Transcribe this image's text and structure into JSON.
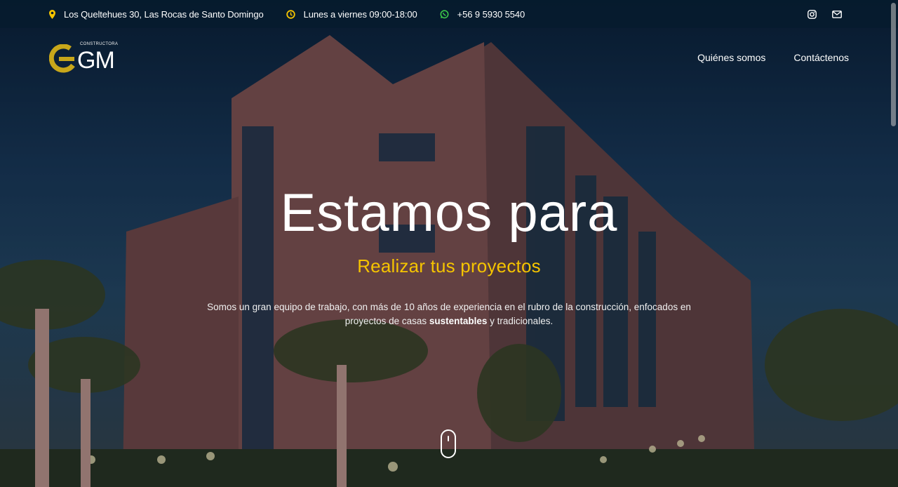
{
  "topbar": {
    "address": "Los Queltehues 30, Las Rocas de Santo Domingo",
    "hours": "Lunes a viernes 09:00-18:00",
    "phone": "+56 9 5930 5540",
    "icons": {
      "address": "map-marker-icon",
      "hours": "clock-icon",
      "phone": "whatsapp-icon",
      "social": [
        "instagram-icon",
        "mail-icon"
      ]
    }
  },
  "logo": {
    "small_text": "CONSTRUCTORA",
    "text": "GM"
  },
  "nav": {
    "items": [
      {
        "label": "Quiénes somos"
      },
      {
        "label": "Contáctenos"
      }
    ]
  },
  "hero": {
    "title": "Estamos para",
    "subtitle": "Realizar tus proyectos",
    "description_part1": "Somos un gran equipo de trabajo, con más de 10 años de experiencia en el rubro de la construcción, enfocados en proyectos de casas ",
    "description_bold": "sustentables",
    "description_part2": " y tradicionales."
  },
  "colors": {
    "accent": "#f5c400",
    "whatsapp": "#3ecf4a",
    "topbar_bg": "#061c2e"
  }
}
